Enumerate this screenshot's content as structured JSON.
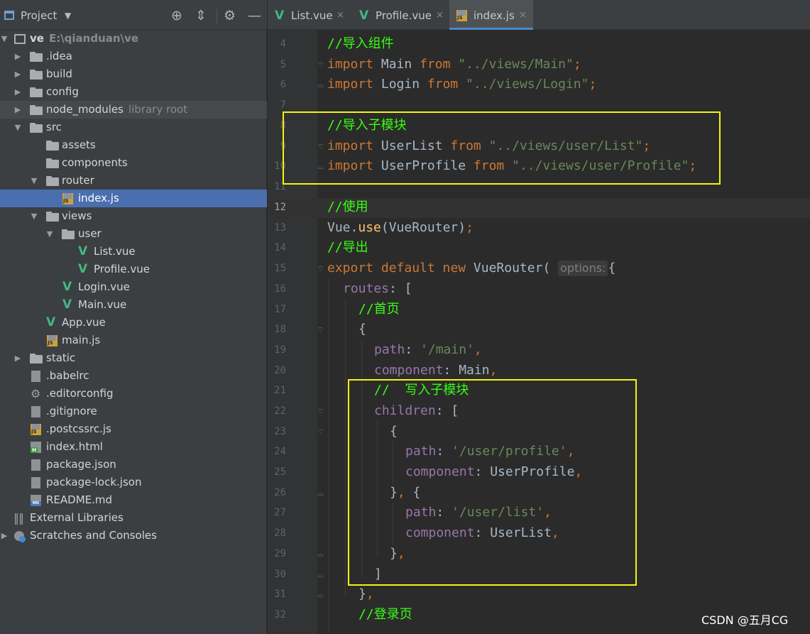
{
  "project_panel": {
    "title": "Project",
    "tree": [
      {
        "label": "ve",
        "sub": "E:\\qianduan\\ve",
        "icon": "project-root-icon",
        "arrow": "expanded"
      },
      {
        "label": ".idea",
        "icon": "folder-icon",
        "arrow": "collapsed"
      },
      {
        "label": "build",
        "icon": "folder-icon",
        "arrow": "collapsed"
      },
      {
        "label": "config",
        "icon": "folder-icon",
        "arrow": "collapsed"
      },
      {
        "label": "node_modules",
        "sub": "library root",
        "icon": "folder-icon",
        "arrow": "collapsed"
      },
      {
        "label": "src",
        "icon": "folder-icon",
        "arrow": "expanded"
      },
      {
        "label": "assets",
        "icon": "folder-icon"
      },
      {
        "label": "components",
        "icon": "folder-icon"
      },
      {
        "label": "router",
        "icon": "folder-icon",
        "arrow": "expanded"
      },
      {
        "label": "index.js",
        "icon": "js-file-icon",
        "selected": true
      },
      {
        "label": "views",
        "icon": "folder-icon",
        "arrow": "expanded"
      },
      {
        "label": "user",
        "icon": "folder-icon",
        "arrow": "expanded"
      },
      {
        "label": "List.vue",
        "icon": "vue-file-icon"
      },
      {
        "label": "Profile.vue",
        "icon": "vue-file-icon"
      },
      {
        "label": "Login.vue",
        "icon": "vue-file-icon"
      },
      {
        "label": "Main.vue",
        "icon": "vue-file-icon"
      },
      {
        "label": "App.vue",
        "icon": "vue-file-icon"
      },
      {
        "label": "main.js",
        "icon": "js-file-icon"
      },
      {
        "label": "static",
        "icon": "folder-icon",
        "arrow": "collapsed"
      },
      {
        "label": ".babelrc",
        "icon": "config-file-icon"
      },
      {
        "label": ".editorconfig",
        "icon": "gear-file-icon"
      },
      {
        "label": ".gitignore",
        "icon": "ignore-file-icon"
      },
      {
        "label": ".postcssrc.js",
        "icon": "js-file-icon"
      },
      {
        "label": "index.html",
        "icon": "html-file-icon"
      },
      {
        "label": "package.json",
        "icon": "json-file-icon"
      },
      {
        "label": "package-lock.json",
        "icon": "json-file-icon"
      },
      {
        "label": "README.md",
        "icon": "markdown-file-icon"
      },
      {
        "label": "External Libraries",
        "icon": "library-icon",
        "arrow": "collapsed"
      },
      {
        "label": "Scratches and Consoles",
        "icon": "scratches-icon",
        "arrow": "collapsed"
      }
    ]
  },
  "editor": {
    "tabs": [
      {
        "label": "List.vue",
        "icon": "vue-file-icon",
        "active": false
      },
      {
        "label": "Profile.vue",
        "icon": "vue-file-icon",
        "active": false
      },
      {
        "label": "index.js",
        "icon": "js-file-icon",
        "active": true
      }
    ],
    "tab_close": "×",
    "current_line": "12",
    "lines": [
      {
        "n": "4",
        "text": "//导入组件"
      },
      {
        "n": "5",
        "text": "import Main from \"../views/Main\";"
      },
      {
        "n": "6",
        "text": "import Login from \"../views/Login\";"
      },
      {
        "n": "7",
        "text": ""
      },
      {
        "n": "8",
        "text": "//导入子模块"
      },
      {
        "n": "9",
        "text": "import UserList from \"../views/user/List\";"
      },
      {
        "n": "10",
        "text": "import UserProfile from \"../views/user/Profile\";"
      },
      {
        "n": "11",
        "text": ""
      },
      {
        "n": "12",
        "text": "//使用"
      },
      {
        "n": "13",
        "text": "Vue.use(VueRouter);"
      },
      {
        "n": "14",
        "text": "//导出"
      },
      {
        "n": "15",
        "text": "export default new VueRouter( options: {"
      },
      {
        "n": "16",
        "text": "routes: ["
      },
      {
        "n": "17",
        "text": "//首页"
      },
      {
        "n": "18",
        "text": "{"
      },
      {
        "n": "19",
        "text": "path: '/main',"
      },
      {
        "n": "20",
        "text": "component: Main,"
      },
      {
        "n": "21",
        "text": "//  写入子模块"
      },
      {
        "n": "22",
        "text": "children: ["
      },
      {
        "n": "23",
        "text": "{"
      },
      {
        "n": "24",
        "text": "path: '/user/profile',"
      },
      {
        "n": "25",
        "text": "component: UserProfile,"
      },
      {
        "n": "26",
        "text": "}, {"
      },
      {
        "n": "27",
        "text": "path: '/user/list',"
      },
      {
        "n": "28",
        "text": "component: UserList,"
      },
      {
        "n": "29",
        "text": "},"
      },
      {
        "n": "30",
        "text": "]"
      },
      {
        "n": "31",
        "text": "},"
      },
      {
        "n": "32",
        "text": "//登录页"
      }
    ],
    "param_hint": "options:"
  },
  "watermark": "CSDN @五月CG",
  "colors": {
    "keyword": "#cc7832",
    "string": "#6a8759",
    "comment": "#39ff14",
    "property": "#9876aa",
    "highlight_box": "#f4f40d",
    "selection": "#4b6eaf"
  }
}
